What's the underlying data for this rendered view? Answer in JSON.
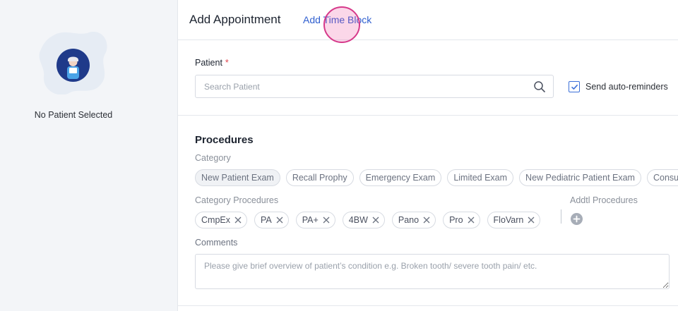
{
  "left_panel": {
    "status_text": "No Patient Selected"
  },
  "header": {
    "title": "Add Appointment",
    "tab_link": "Add Time Block"
  },
  "patient": {
    "label": "Patient",
    "required_mark": "*",
    "search_placeholder": "Search Patient",
    "reminder_label": "Send auto-reminders",
    "reminder_checked": true
  },
  "procedures": {
    "title": "Procedures",
    "category_label": "Category",
    "categories": [
      "New Patient Exam",
      "Recall Prophy",
      "Emergency Exam",
      "Limited Exam",
      "New Pediatric Patient Exam",
      "Consultation"
    ],
    "selected_category": "New Patient Exam",
    "category_procedures_label": "Category Procedures",
    "category_procedures": [
      "CmpEx",
      "PA",
      "PA+",
      "4BW",
      "Pano",
      "Pro",
      "FloVarn"
    ],
    "addtl_procedures_label": "Addtl Procedures",
    "comments_label": "Comments",
    "comments_placeholder": "Please give brief overview of patient’s condition e.g. Broken tooth/ severe tooth pain/ etc."
  },
  "colors": {
    "accent": "#2f5fd0",
    "required": "#e0454d",
    "avatar_bg": "#1f3a8a",
    "panel_bg": "#f3f5f8"
  },
  "icons": {
    "search": "search-icon",
    "remove": "close-icon",
    "add": "plus-circle-icon",
    "checkbox": "checkbox-checked-icon"
  }
}
